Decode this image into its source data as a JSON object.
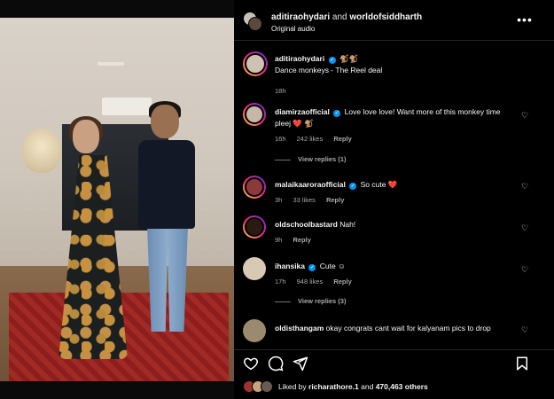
{
  "header": {
    "user1": "aditiraohydari",
    "and": "and",
    "user2": "worldofsiddharth",
    "audio": "Original audio",
    "more_icon": "more-horizontal-icon"
  },
  "caption": {
    "user": "aditiraohydari",
    "emojis": "🐒🐒",
    "text": "Dance monkeys - The Reel deal",
    "time": "18h"
  },
  "comments": [
    {
      "user": "diamirzaofficial",
      "text": "Love love love! Want more of this monkey time pleej ❤️ 🐒",
      "time": "16h",
      "likes": "242 likes",
      "reply": "Reply",
      "view_replies": "View replies (1)"
    },
    {
      "user": "malaikaaroraofficial",
      "text": "So cute ❤️",
      "time": "3h",
      "likes": "33 likes",
      "reply": "Reply"
    },
    {
      "user": "oldschoolbastard",
      "text": "Nah!",
      "time": "9h",
      "reply": "Reply"
    },
    {
      "user": "ihansika",
      "text": "Cute ☺",
      "time": "17h",
      "likes": "948 likes",
      "reply": "Reply",
      "view_replies": "View replies (3)"
    },
    {
      "user": "oldisthangam",
      "text": "okay congrats cant wait for kalyanam pics to drop"
    }
  ],
  "likes": {
    "prefix": "Liked by",
    "user": "richarathore.1",
    "suffix": "and",
    "others": "470,463 others"
  },
  "colors": {
    "background": "#000000",
    "verified": "#0095f6",
    "muted_text": "#a8a8a8"
  }
}
